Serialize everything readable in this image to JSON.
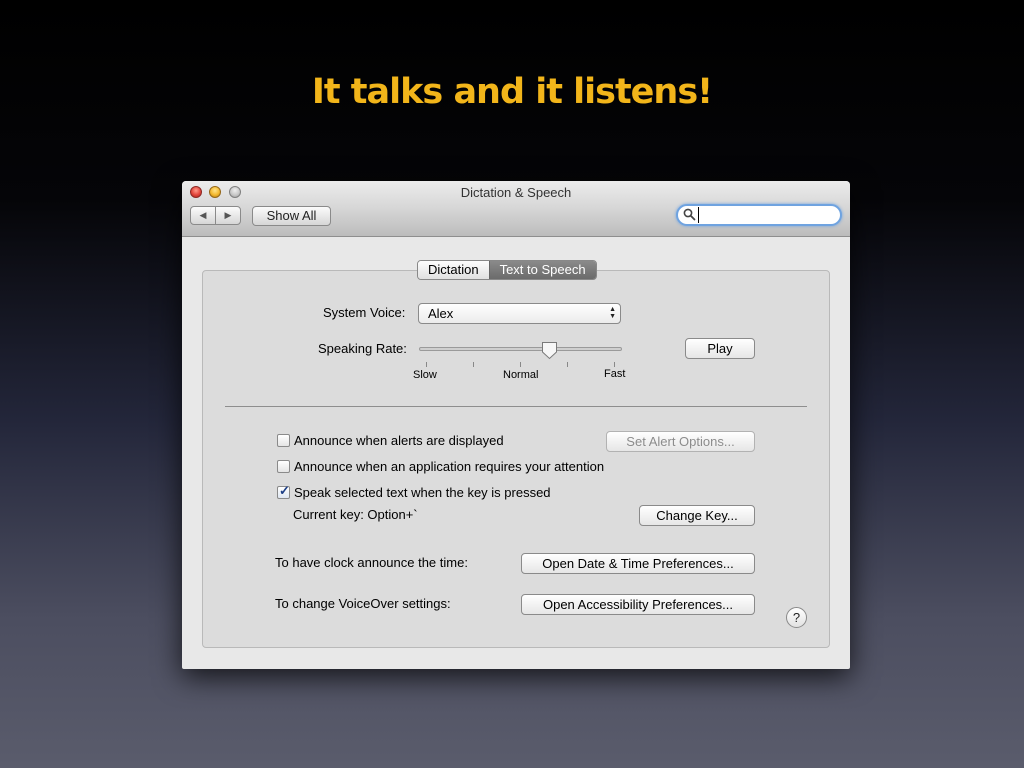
{
  "slide": {
    "title": "It talks and it listens!"
  },
  "window": {
    "title": "Dictation & Speech",
    "toolbar": {
      "back_icon": "◀",
      "forward_icon": "▶",
      "show_all_label": "Show All",
      "search_value": "",
      "search_icon": "magnifier-icon"
    }
  },
  "tabs": [
    {
      "label": "Dictation",
      "selected": false
    },
    {
      "label": "Text to Speech",
      "selected": true
    }
  ],
  "speech": {
    "system_voice_label": "System Voice:",
    "system_voice_value": "Alex",
    "speaking_rate_label": "Speaking Rate:",
    "rate_ticks": [
      "Slow",
      "Normal",
      "Fast"
    ],
    "rate_level": 0.6,
    "play_label": "Play"
  },
  "options": {
    "announce_alerts": {
      "label": "Announce when alerts are displayed",
      "checked": false
    },
    "alert_options_label": "Set Alert Options...",
    "announce_attention": {
      "label": "Announce when an application requires your attention",
      "checked": false
    },
    "speak_selected": {
      "label": "Speak selected text when the key is pressed",
      "checked": true
    },
    "current_key_label": "Current key: Option+`",
    "change_key_label": "Change Key...",
    "clock_label": "To have clock announce the time:",
    "date_time_button": "Open Date & Time Preferences...",
    "voiceover_label": "To change VoiceOver settings:",
    "accessibility_button": "Open Accessibility Preferences...",
    "help_label": "?"
  },
  "colors": {
    "title_accent": "#f2b51a",
    "search_focus": "#6fa3e0",
    "selected_tab": "#6b6b6b"
  }
}
